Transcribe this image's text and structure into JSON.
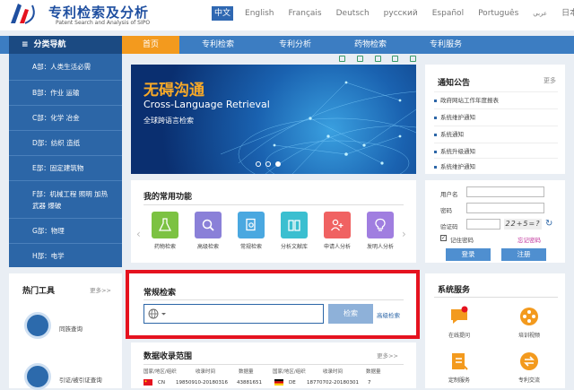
{
  "header": {
    "title": "专利检索及分析",
    "subtitle": "Patent Search and Analysis of SIPO",
    "languages": [
      "中文",
      "English",
      "Français",
      "Deutsch",
      "русский",
      "Español",
      "Português",
      "عربي",
      "日本語"
    ],
    "active_language": "中文"
  },
  "nav": {
    "side_title": "分类导航",
    "items": [
      "首页",
      "专利检索",
      "专利分析",
      "药物检索",
      "专利服务"
    ],
    "active": "首页"
  },
  "sidebar": {
    "items": [
      "A部：人类生活必需",
      "B部：作业 运输",
      "C部：化学 冶金",
      "D部：纺织 造纸",
      "E部：固定建筑物",
      "F部：机械工程 照明 加热 武器 爆破",
      "G部：物理",
      "H部：电学"
    ]
  },
  "banner": {
    "title_cn": "无碍沟通",
    "title_en": "Cross-Language Retrieval",
    "caption": "全球跨语言检索"
  },
  "notice": {
    "title": "通知公告",
    "more": "更多",
    "items": [
      "政府网站工作年度报表",
      "系统维护通知",
      "系统通知",
      "系统升级通知",
      "系统维护通知"
    ]
  },
  "functions": {
    "title": "我的常用功能",
    "items": [
      {
        "label": "药物检索",
        "icon": "flask-icon",
        "color": "#7cc242"
      },
      {
        "label": "高级检索",
        "icon": "magnifier-icon",
        "color": "#8a80d8"
      },
      {
        "label": "常规检索",
        "icon": "doc-search-icon",
        "color": "#4aa8e0"
      },
      {
        "label": "分析文献库",
        "icon": "book-icon",
        "color": "#3bbfd0"
      },
      {
        "label": "申请人分析",
        "icon": "person-add-icon",
        "color": "#f06262"
      },
      {
        "label": "发明人分析",
        "icon": "bulb-icon",
        "color": "#a07ee0"
      }
    ]
  },
  "login": {
    "username_label": "用户名",
    "password_label": "密码",
    "captcha_label": "验证码",
    "captcha_text": "22+5=?",
    "remember_label": "记住密码",
    "forgot_label": "忘记密码",
    "login_button": "登录",
    "register_button": "注册"
  },
  "tools": {
    "title": "热门工具",
    "more": "更多>>",
    "items": [
      "同族查询",
      "引证/被引证查询"
    ]
  },
  "search": {
    "title": "常规检索",
    "button": "检索",
    "advanced_link": "高级检索"
  },
  "scope": {
    "title": "数据收录范围",
    "more": "更多>>",
    "headers": [
      "国家/地区/组织",
      "收录时间",
      "数据量",
      "国家/地区/组织",
      "收录时间",
      "数据量"
    ],
    "rows": [
      [
        "CN",
        "19850910-20180316",
        "43881651",
        "DE",
        "18770702-20180301",
        "7"
      ]
    ]
  },
  "services": {
    "title": "系统服务",
    "items": [
      "在线提问",
      "培训视频",
      "定制服务",
      "专利交流"
    ]
  }
}
